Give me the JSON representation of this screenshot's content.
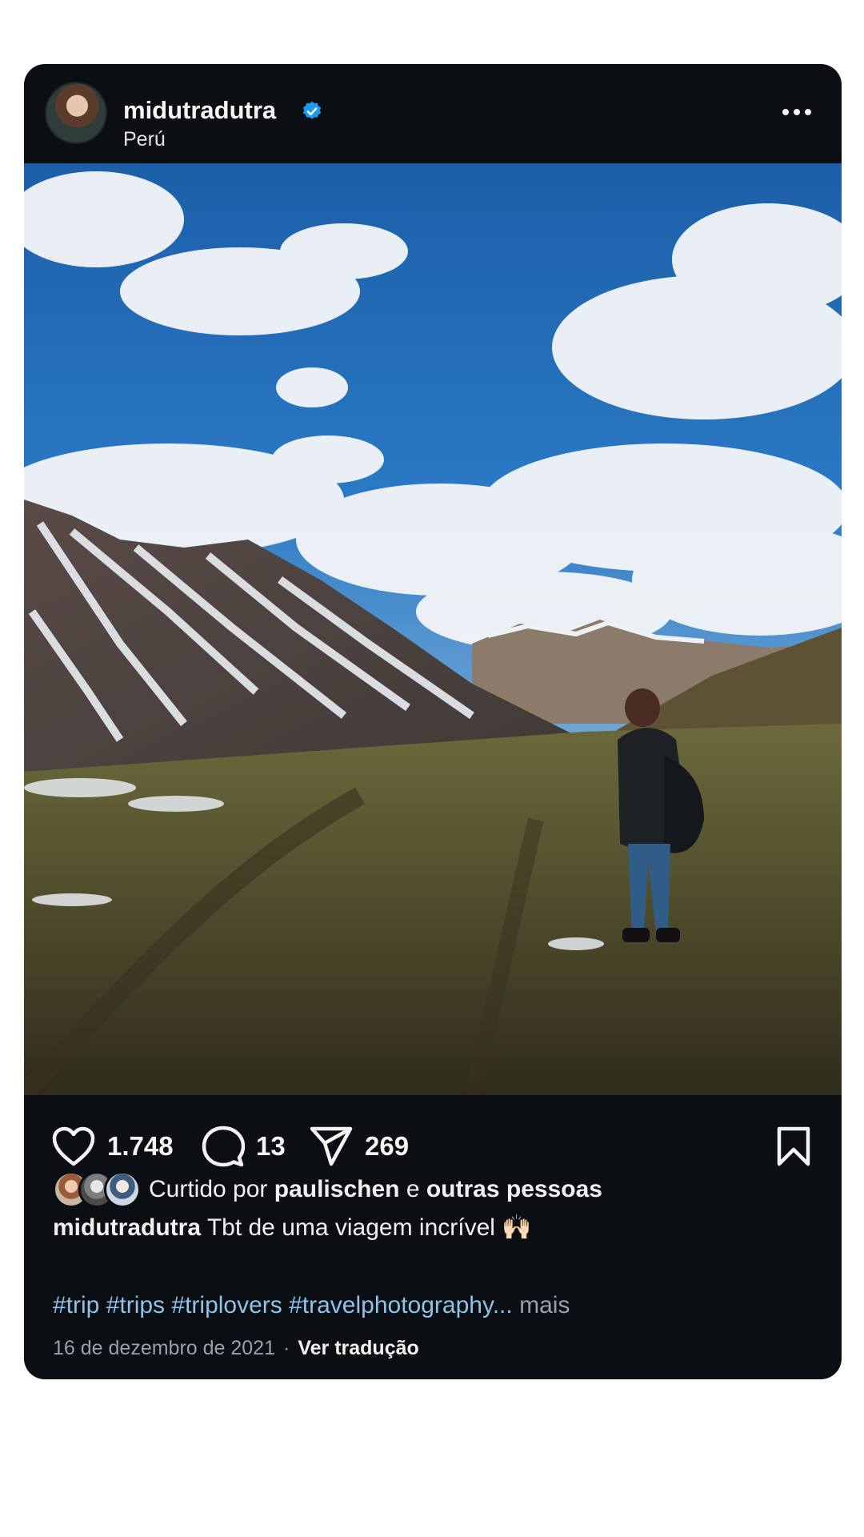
{
  "post": {
    "username": "midutradutra",
    "location": "Perú",
    "likes_count": "1.748",
    "comments_count": "13",
    "shares_count": "269",
    "liked_by_prefix": "Curtido por",
    "liked_by_user": "paulischen",
    "liked_by_and": "e",
    "liked_by_others": "outras pessoas",
    "caption_user": "midutradutra",
    "caption_text": "Tbt de uma viagem incrível 🙌🏻",
    "hashtags": "#trip #trips #triplovers #travelphotography...",
    "more_label": "mais",
    "date": "16 de dezembro de 2021",
    "separator": "·",
    "translate_label": "Ver tradução"
  },
  "icons": {
    "verified": "verified-badge-icon",
    "more": "more-options-icon",
    "like": "heart-icon",
    "comment": "comment-bubble-icon",
    "share": "paper-plane-icon",
    "save": "bookmark-icon"
  },
  "colors": {
    "card_background": "#0b0f13",
    "verified_blue": "#1d9bf0",
    "hashtag_blue": "#8fc3ea",
    "muted_text": "#9aa0a6"
  }
}
